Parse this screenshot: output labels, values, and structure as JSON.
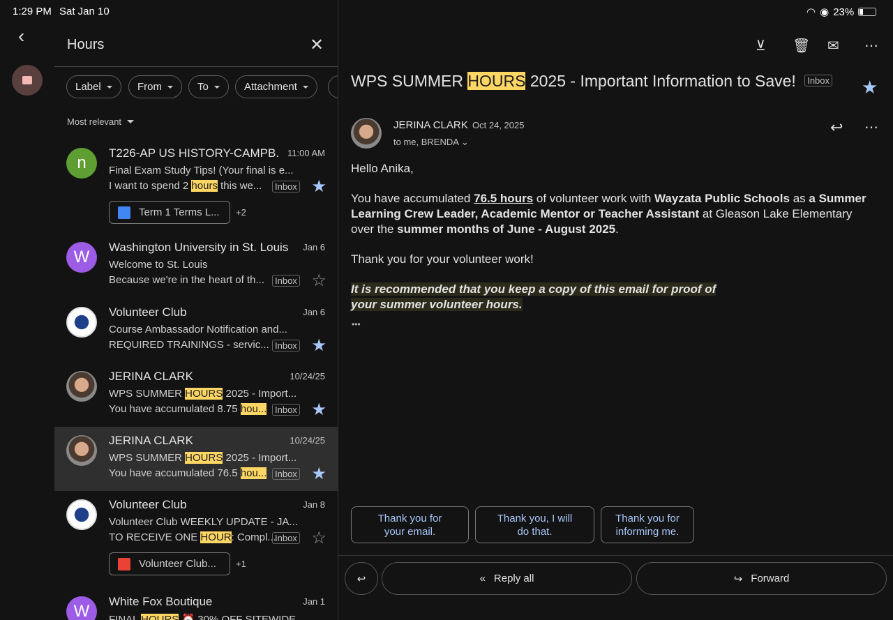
{
  "status": {
    "time": "1:29 PM",
    "date": "Sat Jan 10",
    "battery": "23%"
  },
  "search": {
    "query": "Hours",
    "filters": [
      "Label",
      "From",
      "To",
      "Attachment"
    ],
    "sort": "Most relevant"
  },
  "emails": [
    {
      "sender": "T226-AP US HISTORY-CAMPB.",
      "avatar": "n",
      "avatar_color": "#5e9e32",
      "date": "11:00 AM",
      "subject": "Final Exam Study Tips!  (Your final is e...",
      "snip_pre": "I want to spend 2 ",
      "snip_hl": "hours",
      "snip_post": " this we...",
      "badge": "Inbox",
      "starred": true,
      "attachment": "Term 1 Terms L...",
      "attachment_more": "+2",
      "attachment_color": "#4285f4"
    },
    {
      "sender": "Washington University in St. Louis",
      "avatar": "W",
      "avatar_color": "#9c5ce6",
      "date": "Jan 6",
      "subject": "Welcome to St. Louis",
      "snip_pre": "Because we're in the heart of th...",
      "snip_hl": "",
      "snip_post": "",
      "badge": "Inbox",
      "starred": false
    },
    {
      "sender": "Volunteer Club",
      "avatar": "",
      "date": "Jan 6",
      "subject": "Course Ambassador Notification and...",
      "snip_pre": "REQUIRED TRAININGS - servic...",
      "snip_hl": "",
      "snip_post": "",
      "badge": "Inbox",
      "starred": true
    },
    {
      "sender": "JERINA CLARK",
      "avatar": "",
      "date": "10/24/25",
      "subject_pre": "WPS SUMMER ",
      "subject_hl": "HOURS",
      "subject_post": " 2025 - Import...",
      "snip_pre": "You have accumulated 8.75 ",
      "snip_hl": "hou...",
      "snip_post": "",
      "badge": "Inbox",
      "starred": true
    },
    {
      "sender": "JERINA CLARK",
      "avatar": "",
      "date": "10/24/25",
      "subject_pre": "WPS SUMMER ",
      "subject_hl": "HOURS",
      "subject_post": " 2025 - Import...",
      "snip_pre": "You have accumulated 76.5 ",
      "snip_hl": "hou...",
      "snip_post": "",
      "badge": "Inbox",
      "starred": true,
      "selected": true
    },
    {
      "sender": "Volunteer Club",
      "avatar": "",
      "date": "Jan 8",
      "subject": "Volunteer Club WEEKLY UPDATE - JA...",
      "snip_pre": "TO RECEIVE ONE ",
      "snip_hl": "HOUR",
      "snip_post": ": Compl...",
      "badge": "Inbox",
      "starred": false,
      "attachment": "Volunteer Club...",
      "attachment_more": "+1",
      "attachment_color": "#ea4335"
    },
    {
      "sender": "White Fox Boutique",
      "avatar": "W",
      "avatar_color": "#9c5ce6",
      "date": "Jan 1",
      "subject_pre": "FINAL ",
      "subject_hl": "HOURS",
      "subject_post": " ⏰ 30% OFF SITEWIDE"
    }
  ],
  "message": {
    "title_pre": "WPS SUMMER ",
    "title_hl": "HOURS",
    "title_post": " 2025 - Important Information to Save!",
    "label": "Inbox",
    "starred": true,
    "sender": "JERINA CLARK",
    "date": "Oct 24, 2025",
    "recipients": "to me, BRENDA",
    "greeting": "Hello Anika,",
    "p1": [
      {
        "t": "You have accumulated "
      },
      {
        "t": "76.5 hours",
        "b": true,
        "u": true
      },
      {
        "t": " of volunteer work with "
      },
      {
        "t": "Wayzata Public Schools",
        "b": true
      },
      {
        "t": " as "
      },
      {
        "t": "a Summer Learning Crew Leader, Academic Mentor or Teacher Assistant",
        "b": true
      },
      {
        "t": " at Gleason Lake Elementary over the "
      },
      {
        "t": "summer months of June - August 2025",
        "b": true
      },
      {
        "t": "."
      }
    ],
    "p2": "Thank you for your volunteer work!",
    "p3_line1": "It is recommended that you keep a copy of this email for proof of",
    "p3_line2": "your summer volunteer hours.",
    "more": "•••"
  },
  "smart_replies": [
    "Thank you for your email.",
    "Thank you, I will do that.",
    "Thank you for informing me."
  ],
  "actions": {
    "reply_all": "Reply all",
    "forward": "Forward"
  }
}
